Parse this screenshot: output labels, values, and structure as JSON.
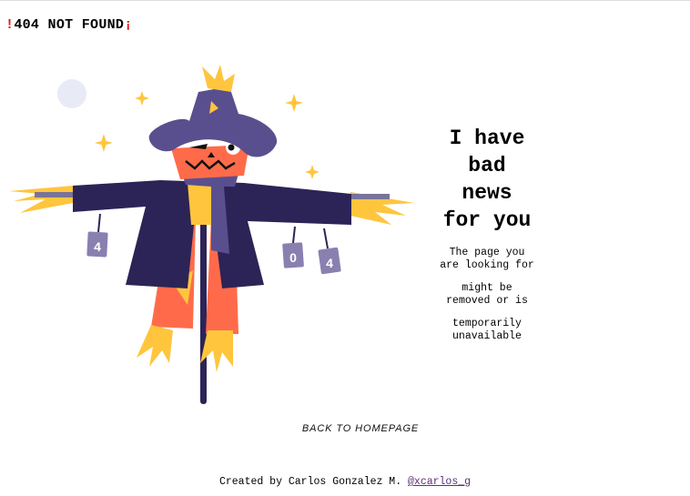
{
  "header": {
    "open_mark": "!",
    "title": "404 NOT FOUND",
    "close_mark": "¡"
  },
  "illustration": {
    "can_labels": [
      "4",
      "0",
      "4"
    ],
    "colors": {
      "hat": "#5a4f8e",
      "jacket": "#2c2456",
      "face": "#ff6b4a",
      "straw": "#ffc53d",
      "pole": "#2c2456",
      "moon": "#e8ebf5",
      "cans": "#8a80b0"
    }
  },
  "message": {
    "headline_lines": [
      "I have",
      "bad",
      "news",
      "for you"
    ],
    "para1_lines": [
      "The page you",
      "are looking for"
    ],
    "para2_lines": [
      "might be",
      "removed or is"
    ],
    "para3_lines": [
      "temporarily",
      "unavailable"
    ]
  },
  "nav": {
    "back_label": "BACK TO HOMEPAGE"
  },
  "footer": {
    "credit_text": "Created by Carlos Gonzalez M. ",
    "handle": "@xcarlos_g"
  }
}
